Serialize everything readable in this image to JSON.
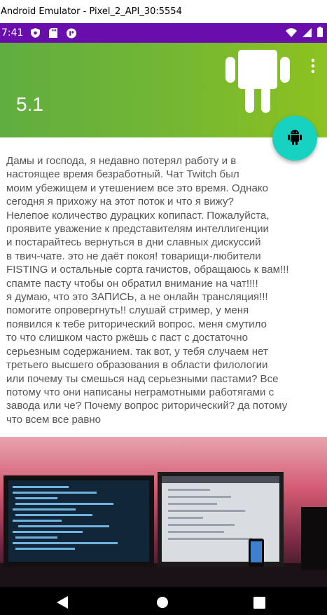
{
  "window": {
    "title": "Android Emulator - Pixel_2_API_30:5554"
  },
  "status_bar": {
    "time": "7:41",
    "left_icons": [
      "shield-icon",
      "sd-card-icon",
      "app-notification-icon"
    ],
    "right_icons": [
      "wifi-icon",
      "signal-icon",
      "battery-icon"
    ],
    "color": "#6a0dad"
  },
  "app_bar": {
    "title": "5.1",
    "logo_icon": "android-robot-icon",
    "menu_icon": "more-vert-icon",
    "colors": [
      "#60ad40",
      "#8dc21f"
    ]
  },
  "fab": {
    "icon": "android-robot-icon",
    "color": "#16d2c1"
  },
  "content": {
    "text": "Дамы и господа, я недавно потерял работу и в\nнастоящее время безработный. Чат Twitch был\nмоим убежищем и утешением все это время. Однако\nсегодня я прихожу на этот поток и что я вижу?\nНелепое количество дурацких копипаст. Пожалуйста,\nпроявите уважение к представителям интеллигенции\nи постарайтесь вернуться в дни славных дискуссий\nв твич-чате. это не даёт покоя! товарищи-любители\nFISTING и остальные сорта гачистов, обращаюсь к вам!!!\nспамте пасту чтобы он обратил внимание на чат!!!!\nя думаю, что это ЗАПИСЬ, а не онлайн трансляция!!!\nпомогите опровергнуть!! слушай стример, у меня\nпоявился к тебе риторический вопрос. меня смутило\nто что слишком часто ржёшь с паст с достаточно\nсерьезным содержанием. так вот, у тебя случаем нет\nтретьего высшего образования в области филологии\nили почему ты смешься над серьезными пастами? Все\nпотому что они написаны неграмотными работягами с\nзавода или че? Почему вопрос риторический? да потому\nчто всем все равно"
  },
  "image": {
    "subject": "photo-of-monitors"
  },
  "nav_bar": {
    "buttons": [
      "back-button",
      "home-button",
      "recents-button"
    ]
  }
}
